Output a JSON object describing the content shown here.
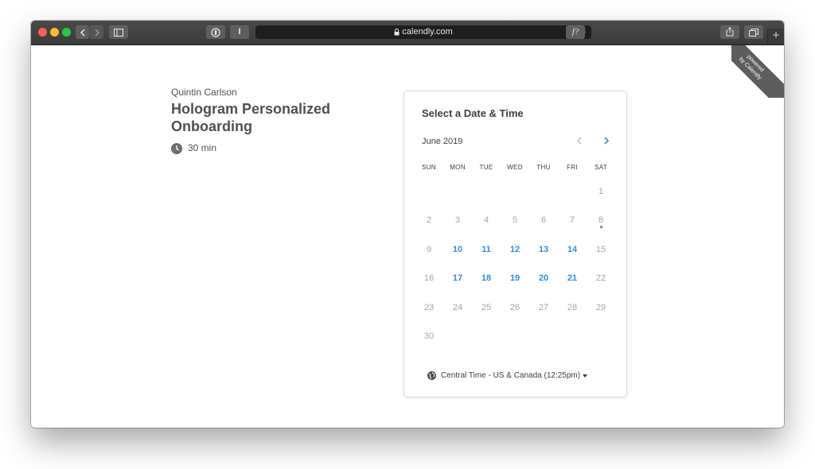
{
  "browser": {
    "url": "calendly.com",
    "reader_label": "I",
    "fontsize_label": "f?",
    "new_tab_label": "+"
  },
  "event": {
    "organizer": "Quintin Carlson",
    "title": "Hologram Personalized Onboarding",
    "duration": "30 min"
  },
  "scheduler": {
    "heading": "Select a Date & Time",
    "month": "June 2019",
    "weekdays": [
      "SUN",
      "MON",
      "TUE",
      "WED",
      "THU",
      "FRI",
      "SAT"
    ],
    "weeks": [
      [
        "",
        "",
        "",
        "",
        "",
        "",
        "1"
      ],
      [
        "2",
        "3",
        "4",
        "5",
        "6",
        "7",
        "8"
      ],
      [
        "9",
        "10",
        "11",
        "12",
        "13",
        "14",
        "15"
      ],
      [
        "16",
        "17",
        "18",
        "19",
        "20",
        "21",
        "22"
      ],
      [
        "23",
        "24",
        "25",
        "26",
        "27",
        "28",
        "29"
      ],
      [
        "30",
        "",
        "",
        "",
        "",
        "",
        ""
      ]
    ],
    "available_days": [
      "10",
      "11",
      "12",
      "13",
      "14",
      "17",
      "18",
      "19",
      "20",
      "21"
    ],
    "today": "8",
    "timezone": "Central Time - US & Canada (12:25pm)"
  },
  "badge": {
    "line1": "powered",
    "line2": "by Calendly"
  },
  "colors": {
    "accent": "#2b8fe6",
    "toolbar": "#3f3f3f"
  }
}
